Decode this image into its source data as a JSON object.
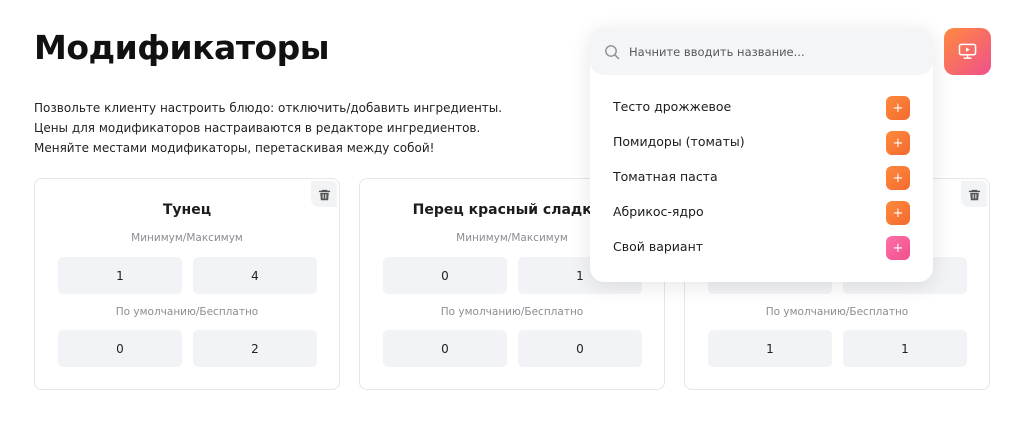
{
  "page": {
    "title": "Модификаторы",
    "description": "Позвольте клиенту настроить блюдо: отключить/добавить ингредиенты. Цены для модификаторов настраиваются в редакторе ингредиентов. Меняйте местами модификаторы, перетаскивая между собой!"
  },
  "cards": [
    {
      "title": "Тунец",
      "minmax_label": "Минимум/Максимум",
      "min": "1",
      "max": "4",
      "default_label": "По умолчанию/Бесплатно",
      "default": "0",
      "free": "2"
    },
    {
      "title": "Перец красный сладкий",
      "minmax_label": "Минимум/Максимум",
      "min": "0",
      "max": "1",
      "default_label": "По умолчанию/Бесплатно",
      "default": "0",
      "free": "0"
    },
    {
      "title": "",
      "minmax_label": "",
      "min": "",
      "max": "",
      "default_label": "По умолчанию/Бесплатно",
      "default": "1",
      "free": "1"
    }
  ],
  "dropdown": {
    "search_placeholder": "Начните вводить название...",
    "options": [
      {
        "label": "Тесто дрожжевое",
        "add": "+"
      },
      {
        "label": "Помидоры (томаты)",
        "add": "+"
      },
      {
        "label": "Томатная паста",
        "add": "+"
      },
      {
        "label": "Абрикос-ядро",
        "add": "+"
      },
      {
        "label": "Свой вариант",
        "add": "+"
      }
    ]
  },
  "icons": {
    "trash": "trash-icon",
    "search": "search-icon",
    "add": "plus-icon",
    "side_button": "screen-preview-icon"
  },
  "colors": {
    "accent_orange": "#f26a30",
    "accent_orange_light": "#ff8a3d",
    "accent_pink": "#f0508c",
    "accent_pink_light": "#ff6fa8",
    "input_bg": "#f2f3f6",
    "border": "#e4e6ea"
  }
}
